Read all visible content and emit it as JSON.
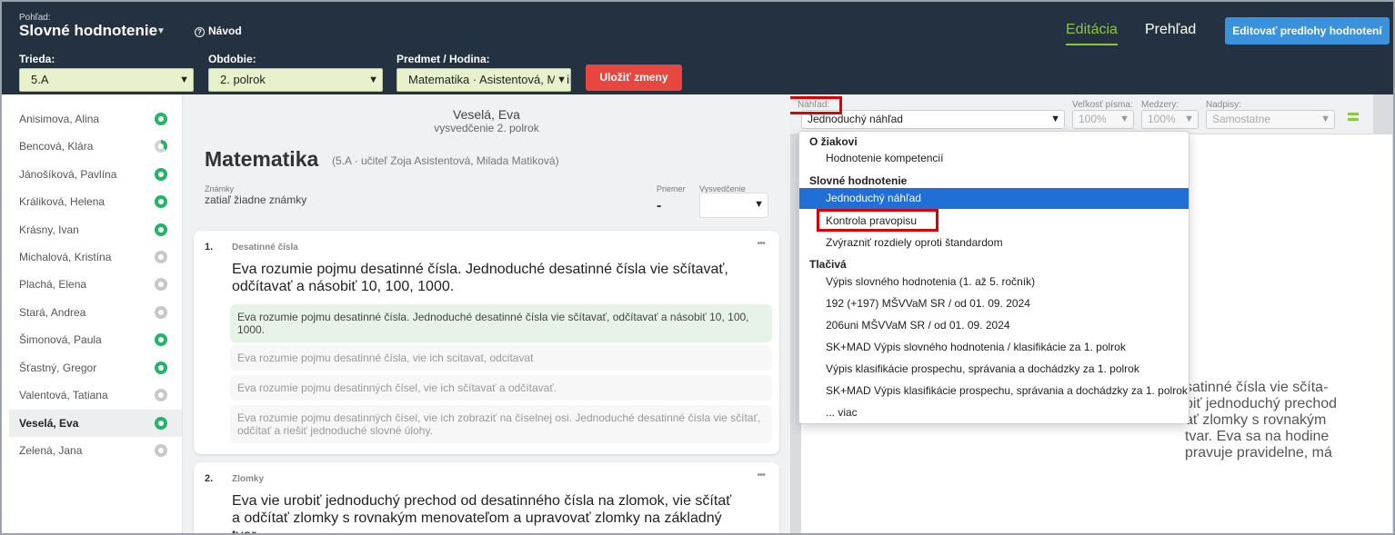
{
  "header": {
    "view_label": "Pohľad:",
    "view_title": "Slovné hodnotenie",
    "help": "Návod",
    "tab_edit": "Editácia",
    "tab_overview": "Prehľad",
    "edit_templates": "Editovať predlohy hodnotení",
    "class_label": "Trieda:",
    "class_value": "5.A",
    "period_label": "Obdobie:",
    "period_value": "2. polrok",
    "subject_label": "Predmet / Hodina:",
    "subject_value": "Matematika · Asistentová, Matiková",
    "save": "Uložiť zmeny"
  },
  "students": [
    {
      "name": "Anisimova, Alina",
      "status": "done"
    },
    {
      "name": "Bencová, Klára",
      "status": "partial"
    },
    {
      "name": "Jánošíková, Pavlína",
      "status": "done"
    },
    {
      "name": "Králiková, Helena",
      "status": "done"
    },
    {
      "name": "Krásny, Ivan",
      "status": "done"
    },
    {
      "name": "Michalová, Kristína",
      "status": "empty"
    },
    {
      "name": "Plachá, Elena",
      "status": "empty"
    },
    {
      "name": "Stará, Andrea",
      "status": "empty"
    },
    {
      "name": "Šimonová, Paula",
      "status": "done"
    },
    {
      "name": "Šťastný, Gregor",
      "status": "done"
    },
    {
      "name": "Valentová, Tatiana",
      "status": "empty"
    },
    {
      "name": "Veselá, Eva",
      "status": "done"
    },
    {
      "name": "Zelená, Jana",
      "status": "empty"
    }
  ],
  "main": {
    "student_name": "Veselá, Eva",
    "student_sub": "vysvedčenie 2. polrok",
    "subject": "Matematika",
    "subject_meta": "(5.A · učiteľ Zoja Asistentová, Milada Matiková)",
    "grades_label": "Známky",
    "grades_value": "zatiaľ žiadne známky",
    "avg_label": "Priemer",
    "avg_value": "-",
    "cert_label": "Vysvedčenie",
    "cards": [
      {
        "num": "1.",
        "title": "Desatinné čísla",
        "dots": "•••",
        "text": "Eva rozumie pojmu desatinné čísla. Jednoduché desatinné čísla vie sčítavať, odčítavať a násobiť 10, 100, 1000.",
        "options": [
          "Eva rozumie pojmu desatinné čísla. Jednoduché desatinné čísla vie sčítavať, odčítavať a násobiť 10, 100, 1000.",
          "Eva rozumie pojmu desatinné čísla, vie ich scitavat, odcitavat",
          "Eva rozumie pojmu desatinných čísel, vie ich sčítavať a odčítavať.",
          "Eva rozumie pojmu desatinných čísel, vie ich zobraziť na číselnej osi. Jednoduché desatinné čísla vie sčítať, odčítať a riešiť jednoduché slovné úlohy."
        ]
      },
      {
        "num": "2.",
        "title": "Zlomky",
        "dots": "•••",
        "text": "Eva vie urobiť jednoduchý prechod od desatinného čísla na zlomok, vie sčítať a odčítať zlomky s rovnakým menovateľom a upravovať zlomky na základný tvar."
      }
    ]
  },
  "preview": {
    "preview_label": "Náhľad:",
    "preview_value": "Jednoduchý náhľad",
    "font_size_label": "Veľkosť písma:",
    "font_size_value": "100%",
    "spacing_label": "Medzery:",
    "spacing_value": "100%",
    "headings_label": "Nadpisy:",
    "headings_value": "Samostatne",
    "doc_lines": [
      "satinné čísla vie sčíta-",
      "biť jednoduchý prechod",
      "ať zlomky s rovnakým",
      "tvar. Eva sa na hodine",
      "pravuje pravidelne, má"
    ]
  },
  "dropdown": {
    "group_student": "O žiakovi",
    "item_competence": "Hodnotenie kompetencií",
    "group_verbal": "Slovné hodnotenie",
    "item_simple": "Jednoduchý náhľad",
    "item_spell": "Kontrola pravopisu",
    "item_diff": "Zvýrazniť rozdiely oproti štandardom",
    "group_print": "Tlačivá",
    "print_items": [
      "Výpis slovného hodnotenia (1. až 5. ročník)",
      "192 (+197) MŠVVaM SR / od 01. 09. 2024",
      "206uni MŠVVaM SR / od 01. 09. 2024",
      "SK+MAD Výpis slovného hodnotenia / klasifikácie za 1. polrok",
      "Výpis klasifikácie prospechu, správania a dochádzky za 1. polrok",
      "SK+MAD Výpis klasifikácie prospechu, správania a dochádzky za 1. polrok",
      "... viac"
    ]
  },
  "colors": {
    "header_bg": "#243140",
    "accent_green": "#8cc63f",
    "primary_blue": "#3a92dc",
    "save_red": "#e8473f",
    "highlight_blue": "#1f6fd6",
    "callout_red": "#e00000"
  }
}
